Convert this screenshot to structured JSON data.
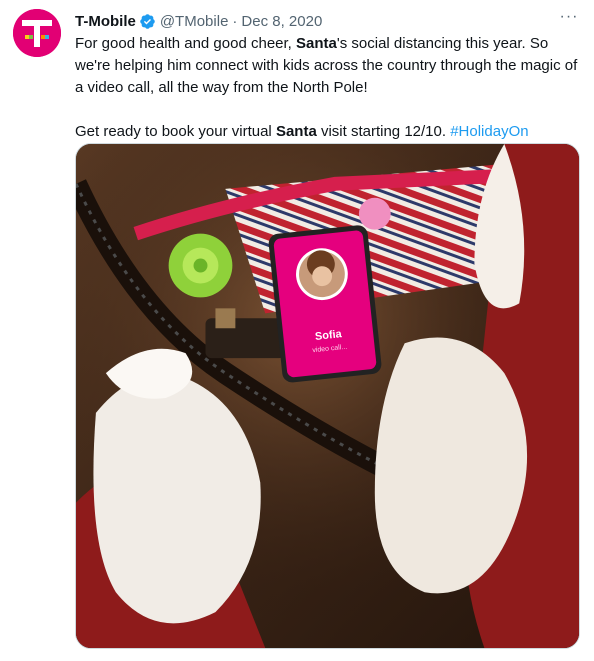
{
  "tweet": {
    "author_name": "T-Mobile",
    "author_handle": "@TMobile",
    "separator": "·",
    "date": "Dec 8, 2020",
    "more_label": "···",
    "paragraph1": {
      "part1": "For good health and good cheer, ",
      "bold1": "Santa",
      "part2": "'s social distancing this year. So we're helping him connect with kids across the country through the magic of a video call, all the way from the North Pole!"
    },
    "paragraph2": {
      "part1": "Get ready to book your virtual ",
      "bold1": "Santa",
      "part2": " visit starting 12/10. ",
      "hashtag": "#HolidayOn"
    }
  },
  "media": {
    "phone_caller_name": "Sofia",
    "phone_caller_status": "video call..."
  },
  "colors": {
    "brand_magenta": "#e20074",
    "verified_blue": "#1d9bf0",
    "link_blue": "#1d9bf0",
    "text_primary": "#0f1419",
    "text_secondary": "#536471"
  },
  "icons": {
    "avatar": "t-mobile-logo",
    "verified": "verified-badge-icon",
    "more": "more-options-icon"
  }
}
